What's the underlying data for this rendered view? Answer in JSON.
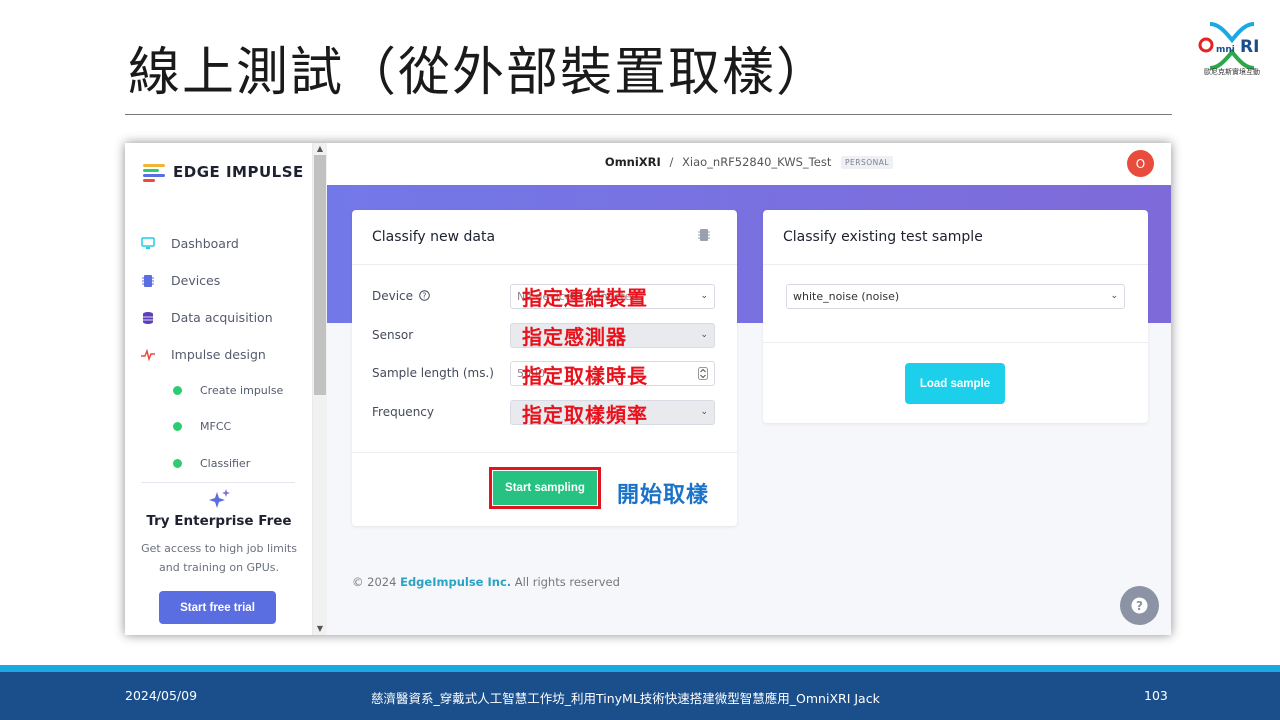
{
  "slide": {
    "title": "線上測試（從外部裝置取樣）",
    "logo_caption": "歐尼克斯實境互動",
    "footer_date": "2024/05/09",
    "footer_center": "慈濟醫資系_穿戴式人工智慧工作坊_利用TinyML技術快速搭建微型智慧應用_OmniXRI  Jack",
    "page_number": "103"
  },
  "colors": {
    "accent_purple": "#7378e8",
    "accent_green": "#26c281",
    "accent_cyan": "#1ccfea",
    "annotation_red": "#e8121c",
    "annotation_blue": "#1a73c8",
    "footer_blue": "#1b4f8c"
  },
  "sidebar": {
    "brand": "EDGE IMPULSE",
    "nav": [
      {
        "label": "Dashboard",
        "icon": "monitor-icon"
      },
      {
        "label": "Devices",
        "icon": "chip-icon"
      },
      {
        "label": "Data acquisition",
        "icon": "database-icon"
      },
      {
        "label": "Impulse design",
        "icon": "pulse-icon"
      }
    ],
    "sub": [
      {
        "label": "Create impulse"
      },
      {
        "label": "MFCC"
      },
      {
        "label": "Classifier"
      }
    ],
    "enterprise_title": "Try Enterprise Free",
    "enterprise_text": "Get access to high job limits and training on GPUs.",
    "trial_button": "Start free trial"
  },
  "topbar": {
    "owner": "OmniXRI",
    "separator": "/",
    "project": "Xiao_nRF52840_KWS_Test",
    "badge": "PERSONAL",
    "avatar_initial": "O"
  },
  "classify_new": {
    "title": "Classify new data",
    "fields": [
      {
        "label": "Device",
        "value": "No devices connected",
        "annotation": "指定連結裝置"
      },
      {
        "label": "Sensor",
        "value": "",
        "annotation": "指定感測器"
      },
      {
        "label": "Sample length (ms.)",
        "value": "5000",
        "annotation": "指定取樣時長"
      },
      {
        "label": "Frequency",
        "value": "",
        "annotation": "指定取樣頻率"
      }
    ],
    "start_button": "Start sampling",
    "start_annotation": "開始取樣"
  },
  "classify_existing": {
    "title": "Classify existing test sample",
    "selected": "white_noise (noise)",
    "load_button": "Load sample"
  },
  "footer": {
    "copyright": "© 2024",
    "company": "EdgeImpulse Inc.",
    "rights": "All rights reserved"
  }
}
